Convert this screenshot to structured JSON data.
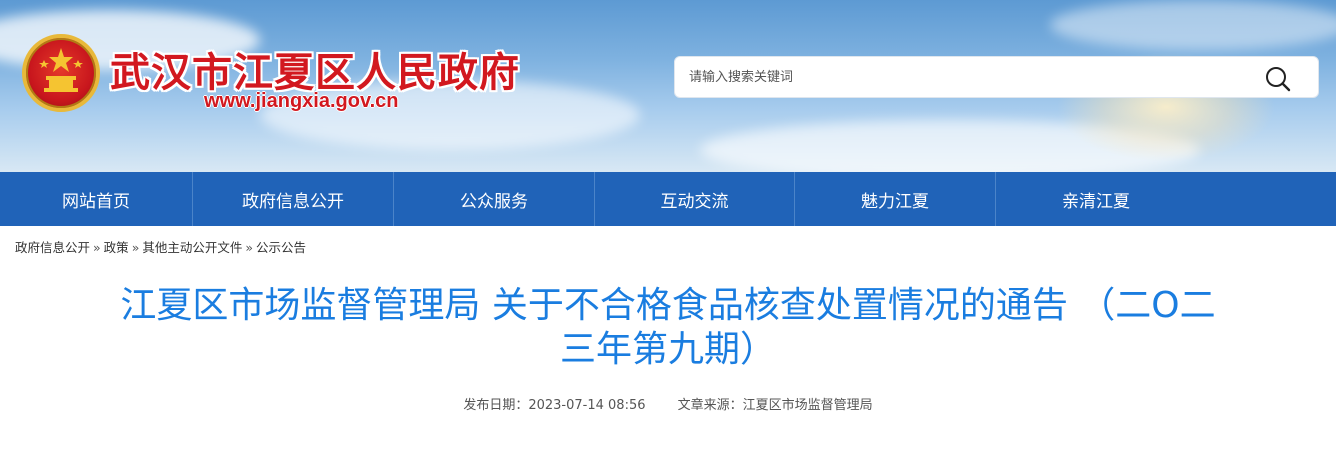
{
  "header": {
    "site_title": "武汉市江夏区人民政府",
    "site_url": "www.jiangxia.gov.cn",
    "search_placeholder": "请输入搜索关键词",
    "colors": {
      "title_red": "#d2181f",
      "nav_blue": "#2063b8",
      "headline_blue": "#1a7de0"
    }
  },
  "nav": {
    "items": [
      {
        "label": "网站首页"
      },
      {
        "label": "政府信息公开"
      },
      {
        "label": "公众服务"
      },
      {
        "label": "互动交流"
      },
      {
        "label": "魅力江夏"
      },
      {
        "label": "亲清江夏"
      }
    ]
  },
  "breadcrumb": {
    "separator": "»",
    "items": [
      {
        "label": "政府信息公开"
      },
      {
        "label": "政策"
      },
      {
        "label": "其他主动公开文件"
      },
      {
        "label": "公示公告"
      }
    ]
  },
  "article": {
    "title_line1": "江夏区市场监督管理局 关于不合格食品核查处置情况的通告 （二O二",
    "title_line2": "三年第九期）",
    "publish_date": "发布日期：2023-07-14 08:56",
    "source": "文章来源：江夏区市场监督管理局"
  },
  "icons": {
    "search": "search-icon",
    "emblem": "national-emblem-icon"
  }
}
